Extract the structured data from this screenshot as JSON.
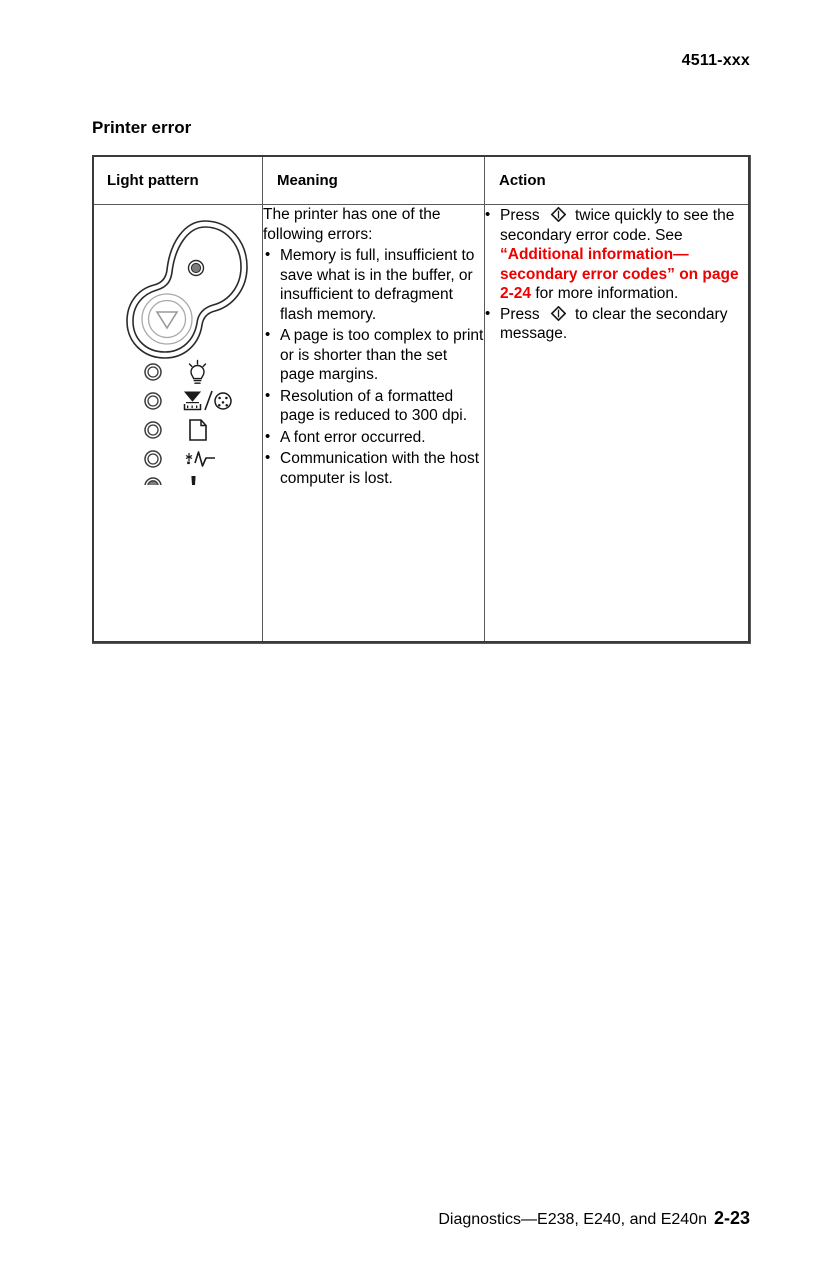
{
  "header": {
    "model_code": "4511-xxx"
  },
  "section": {
    "title": "Printer error"
  },
  "table": {
    "columns": {
      "light_pattern": "Light pattern",
      "meaning": "Meaning",
      "action": "Action"
    },
    "row": {
      "light_pattern": {
        "panel_label": "printer operator panel",
        "indicators": [
          {
            "name": "ready-indicator",
            "icon": "lightbulb-icon",
            "state": "off"
          },
          {
            "name": "load-paper-toner-indicator",
            "icon": "load-paper-toner-low-icon",
            "state": "off"
          },
          {
            "name": "paper-jam-indicator",
            "icon": "paper-sheet-icon",
            "state": "off"
          },
          {
            "name": "press-button-indicator",
            "icon": "toner-waveform-icon",
            "state": "off"
          },
          {
            "name": "error-indicator",
            "icon": "exclamation-icon",
            "state": "on"
          }
        ],
        "panel_led_state": "on",
        "panel_button": "continue-cancel-button"
      },
      "meaning": {
        "intro": "The printer has one of the following errors:",
        "bullets": [
          "Memory is full, insufficient to save what is in the buffer, or insufficient to defragment flash memory.",
          "A page is too complex to print or is shorter than the set page margins.",
          "Resolution of a formatted page is reduced to 300 dpi.",
          "A font error occurred.",
          "Communication with the host computer is lost."
        ]
      },
      "action": {
        "bullet_1": {
          "lead": "Press",
          "button_icon": "continue-button-diamond-icon",
          "mid": "twice quickly to see the secondary error code. See",
          "quote_open": "“Additional information—secondary error codes” on page 2-24",
          "tail": "for more information."
        },
        "bullet_2": {
          "lead": "Press",
          "button_icon": "continue-button-diamond-icon",
          "tail": "to clear the secondary message."
        }
      }
    }
  },
  "footer": {
    "text": "Diagnostics—E238, E240, and E240n",
    "page_number": "2-23"
  },
  "colors": {
    "xref_red": "#ee0000",
    "border": "#5a5a5a",
    "frame": "#3a3a3a",
    "led_on_fill": "#808080"
  }
}
